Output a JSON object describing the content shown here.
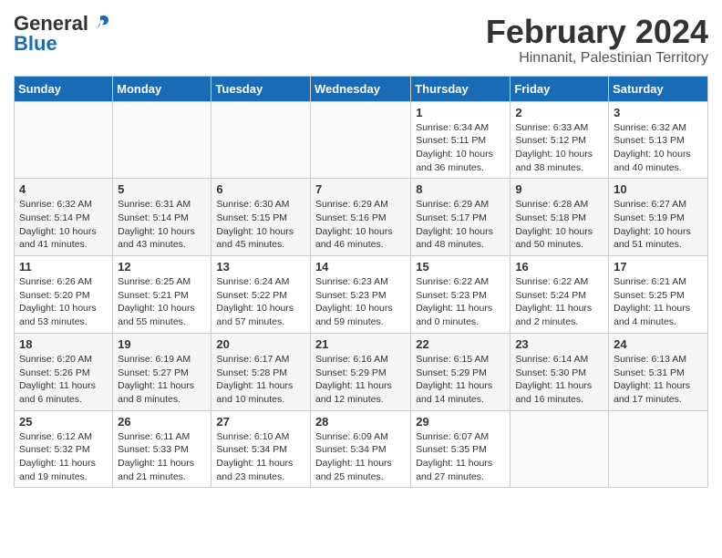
{
  "logo": {
    "general": "General",
    "blue": "Blue"
  },
  "title": "February 2024",
  "subtitle": "Hinnanit, Palestinian Territory",
  "headers": [
    "Sunday",
    "Monday",
    "Tuesday",
    "Wednesday",
    "Thursday",
    "Friday",
    "Saturday"
  ],
  "weeks": [
    [
      {
        "day": "",
        "info": ""
      },
      {
        "day": "",
        "info": ""
      },
      {
        "day": "",
        "info": ""
      },
      {
        "day": "",
        "info": ""
      },
      {
        "day": "1",
        "info": "Sunrise: 6:34 AM\nSunset: 5:11 PM\nDaylight: 10 hours\nand 36 minutes."
      },
      {
        "day": "2",
        "info": "Sunrise: 6:33 AM\nSunset: 5:12 PM\nDaylight: 10 hours\nand 38 minutes."
      },
      {
        "day": "3",
        "info": "Sunrise: 6:32 AM\nSunset: 5:13 PM\nDaylight: 10 hours\nand 40 minutes."
      }
    ],
    [
      {
        "day": "4",
        "info": "Sunrise: 6:32 AM\nSunset: 5:14 PM\nDaylight: 10 hours\nand 41 minutes."
      },
      {
        "day": "5",
        "info": "Sunrise: 6:31 AM\nSunset: 5:14 PM\nDaylight: 10 hours\nand 43 minutes."
      },
      {
        "day": "6",
        "info": "Sunrise: 6:30 AM\nSunset: 5:15 PM\nDaylight: 10 hours\nand 45 minutes."
      },
      {
        "day": "7",
        "info": "Sunrise: 6:29 AM\nSunset: 5:16 PM\nDaylight: 10 hours\nand 46 minutes."
      },
      {
        "day": "8",
        "info": "Sunrise: 6:29 AM\nSunset: 5:17 PM\nDaylight: 10 hours\nand 48 minutes."
      },
      {
        "day": "9",
        "info": "Sunrise: 6:28 AM\nSunset: 5:18 PM\nDaylight: 10 hours\nand 50 minutes."
      },
      {
        "day": "10",
        "info": "Sunrise: 6:27 AM\nSunset: 5:19 PM\nDaylight: 10 hours\nand 51 minutes."
      }
    ],
    [
      {
        "day": "11",
        "info": "Sunrise: 6:26 AM\nSunset: 5:20 PM\nDaylight: 10 hours\nand 53 minutes."
      },
      {
        "day": "12",
        "info": "Sunrise: 6:25 AM\nSunset: 5:21 PM\nDaylight: 10 hours\nand 55 minutes."
      },
      {
        "day": "13",
        "info": "Sunrise: 6:24 AM\nSunset: 5:22 PM\nDaylight: 10 hours\nand 57 minutes."
      },
      {
        "day": "14",
        "info": "Sunrise: 6:23 AM\nSunset: 5:23 PM\nDaylight: 10 hours\nand 59 minutes."
      },
      {
        "day": "15",
        "info": "Sunrise: 6:22 AM\nSunset: 5:23 PM\nDaylight: 11 hours\nand 0 minutes."
      },
      {
        "day": "16",
        "info": "Sunrise: 6:22 AM\nSunset: 5:24 PM\nDaylight: 11 hours\nand 2 minutes."
      },
      {
        "day": "17",
        "info": "Sunrise: 6:21 AM\nSunset: 5:25 PM\nDaylight: 11 hours\nand 4 minutes."
      }
    ],
    [
      {
        "day": "18",
        "info": "Sunrise: 6:20 AM\nSunset: 5:26 PM\nDaylight: 11 hours\nand 6 minutes."
      },
      {
        "day": "19",
        "info": "Sunrise: 6:19 AM\nSunset: 5:27 PM\nDaylight: 11 hours\nand 8 minutes."
      },
      {
        "day": "20",
        "info": "Sunrise: 6:17 AM\nSunset: 5:28 PM\nDaylight: 11 hours\nand 10 minutes."
      },
      {
        "day": "21",
        "info": "Sunrise: 6:16 AM\nSunset: 5:29 PM\nDaylight: 11 hours\nand 12 minutes."
      },
      {
        "day": "22",
        "info": "Sunrise: 6:15 AM\nSunset: 5:29 PM\nDaylight: 11 hours\nand 14 minutes."
      },
      {
        "day": "23",
        "info": "Sunrise: 6:14 AM\nSunset: 5:30 PM\nDaylight: 11 hours\nand 16 minutes."
      },
      {
        "day": "24",
        "info": "Sunrise: 6:13 AM\nSunset: 5:31 PM\nDaylight: 11 hours\nand 17 minutes."
      }
    ],
    [
      {
        "day": "25",
        "info": "Sunrise: 6:12 AM\nSunset: 5:32 PM\nDaylight: 11 hours\nand 19 minutes."
      },
      {
        "day": "26",
        "info": "Sunrise: 6:11 AM\nSunset: 5:33 PM\nDaylight: 11 hours\nand 21 minutes."
      },
      {
        "day": "27",
        "info": "Sunrise: 6:10 AM\nSunset: 5:34 PM\nDaylight: 11 hours\nand 23 minutes."
      },
      {
        "day": "28",
        "info": "Sunrise: 6:09 AM\nSunset: 5:34 PM\nDaylight: 11 hours\nand 25 minutes."
      },
      {
        "day": "29",
        "info": "Sunrise: 6:07 AM\nSunset: 5:35 PM\nDaylight: 11 hours\nand 27 minutes."
      },
      {
        "day": "",
        "info": ""
      },
      {
        "day": "",
        "info": ""
      }
    ]
  ]
}
